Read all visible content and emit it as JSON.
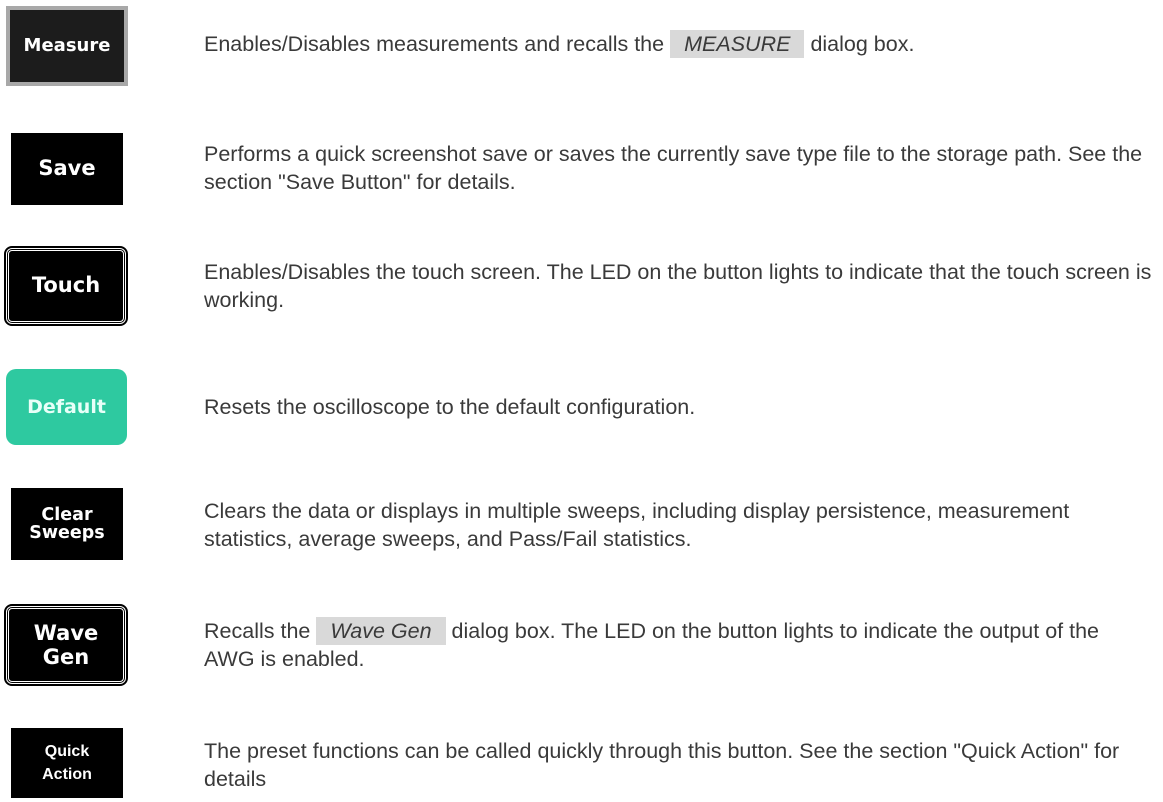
{
  "rows": [
    {
      "button_label": "Measure",
      "description_before": "Enables/Disables measurements and recalls the",
      "highlight": "MEASURE",
      "description_after": "dialog box."
    },
    {
      "button_label": "Save",
      "description": "Performs a quick screenshot save or saves the currently save type file to the storage path. See the section \"Save Button\" for details."
    },
    {
      "button_label": "Touch",
      "description": "Enables/Disables the touch screen. The LED on the button lights to indicate that the touch screen is working."
    },
    {
      "button_label": "Default",
      "description": "Resets the oscilloscope to the default configuration."
    },
    {
      "button_label_line1": "Clear",
      "button_label_line2": "Sweeps",
      "description": "Clears the data or displays in multiple sweeps, including display persistence, measurement statistics, average sweeps, and Pass/Fail statistics."
    },
    {
      "button_label_line1": "Wave",
      "button_label_line2": "Gen",
      "description_before": "Recalls the",
      "highlight": "Wave Gen",
      "description_after": "dialog box. The LED on the button lights to indicate the output of the AWG is enabled."
    },
    {
      "button_label_line1": "Quick",
      "button_label_line2": "Action",
      "description": "The preset functions can be called quickly through this button. See the section \"Quick Action\" for details"
    }
  ],
  "colors": {
    "text": "#3a3a3a",
    "button_dark": "#000000",
    "button_default": "#2ec9a0",
    "highlight_bg": "#d9d9d9"
  }
}
